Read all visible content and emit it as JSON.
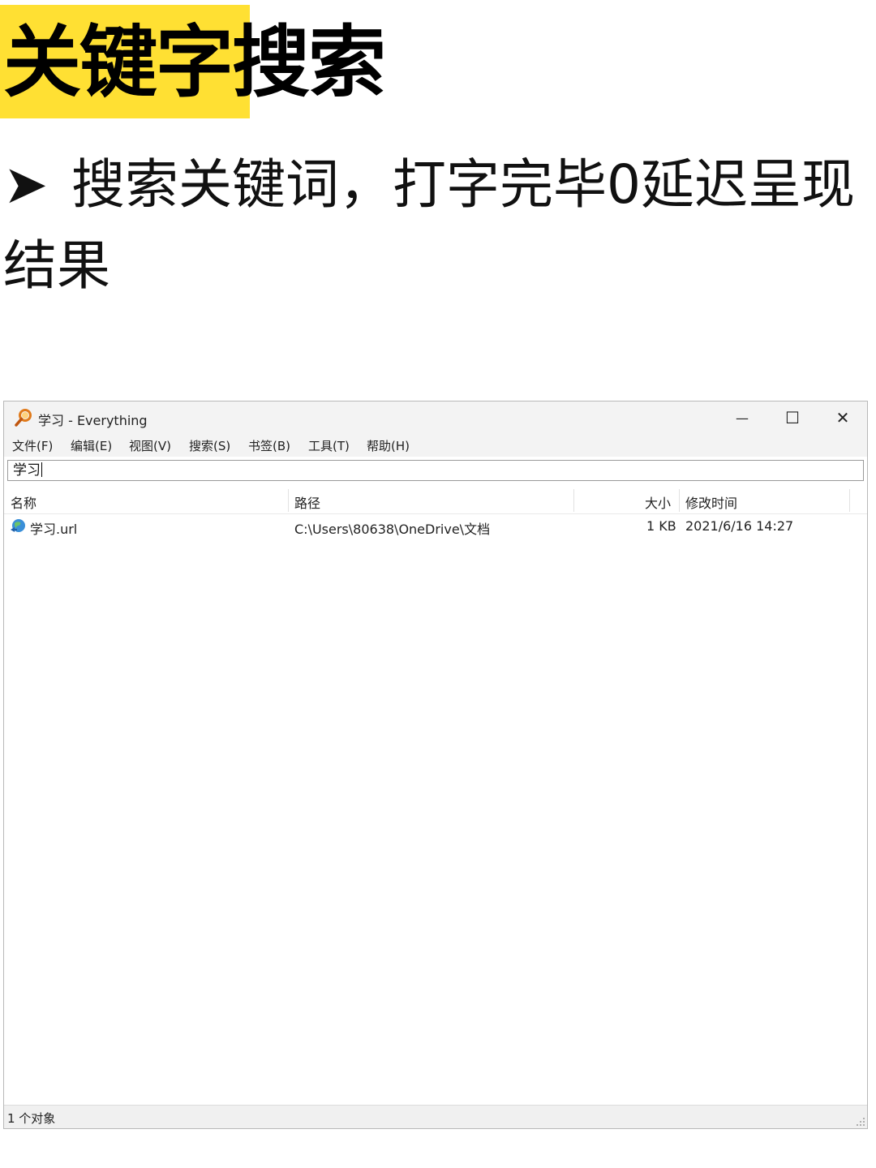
{
  "headline": "关键字搜索",
  "bullet": {
    "arrow": "➤",
    "text": "搜索关键词，打字完毕0延迟呈现结果"
  },
  "window": {
    "title": "学习 - Everything",
    "controls": {
      "minimize": "—",
      "maximize": "☐",
      "close": "✕"
    },
    "menu": [
      "文件(F)",
      "编辑(E)",
      "视图(V)",
      "搜索(S)",
      "书签(B)",
      "工具(T)",
      "帮助(H)"
    ],
    "search_value": "学习",
    "columns": {
      "name": "名称",
      "path": "路径",
      "size": "大小",
      "modified": "修改时间"
    },
    "rows": [
      {
        "name": "学习.url",
        "path": "C:\\Users\\80638\\OneDrive\\文档",
        "size": "1 KB",
        "modified": "2021/6/16 14:27"
      }
    ],
    "status": "1 个对象"
  },
  "colors": {
    "highlight": "#ffe033",
    "window_chrome": "#f3f3f3",
    "app_icon": "#e07a1a"
  }
}
